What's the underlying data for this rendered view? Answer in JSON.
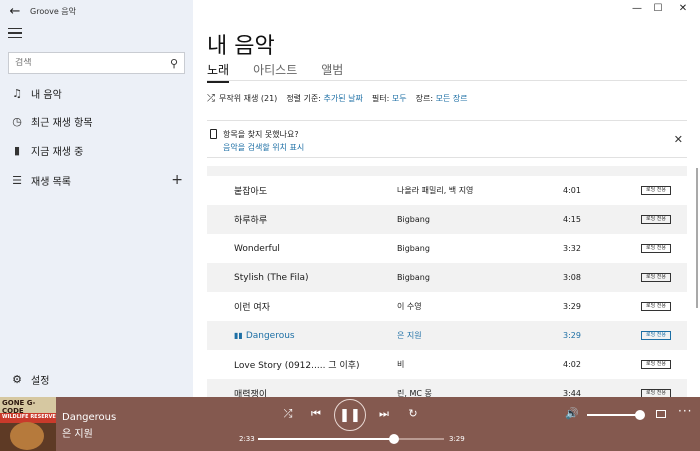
{
  "app": {
    "title": "Groove 음악"
  },
  "search": {
    "placeholder": "검색"
  },
  "sidebar": {
    "items": [
      {
        "label": "내 음악",
        "icon": "music-note-icon"
      },
      {
        "label": "최근 재생 항목",
        "icon": "clock-icon"
      },
      {
        "label": "지금 재생 중",
        "icon": "bars-icon"
      },
      {
        "label": "재생 목록",
        "icon": "list-icon"
      }
    ],
    "add_symbol": "+",
    "settings_label": "설정"
  },
  "main": {
    "title": "내 음악",
    "tabs": [
      {
        "label": "노래",
        "active": true
      },
      {
        "label": "아티스트",
        "active": false
      },
      {
        "label": "앨범",
        "active": false
      }
    ],
    "filters": {
      "shuffle_label": "무작위 재생 (21)",
      "sort_label": "정렬 기준:",
      "sort_value": "추가된 날짜",
      "filter_label": "필터:",
      "filter_value": "모두",
      "genre_label": "장르:",
      "genre_value": "모든 장르"
    },
    "notice": {
      "line1": "항목을 찾지 못했나요?",
      "line2": "음악을 검색할 위치 표시"
    }
  },
  "songs": [
    {
      "title": "붙잡아도",
      "artist": "나올라 패밀리, 백 지영",
      "duration": "4:01",
      "badge": "로딩 전용",
      "playing": false
    },
    {
      "title": "하루하루",
      "artist": "Bigbang",
      "duration": "4:15",
      "badge": "로딩 전용",
      "playing": false
    },
    {
      "title": "Wonderful",
      "artist": "Bigbang",
      "duration": "3:32",
      "badge": "로딩 전용",
      "playing": false
    },
    {
      "title": "Stylish (The Fila)",
      "artist": "Bigbang",
      "duration": "3:08",
      "badge": "로딩 전용",
      "playing": false
    },
    {
      "title": "이런 여자",
      "artist": "이 수영",
      "duration": "3:29",
      "badge": "로딩 전용",
      "playing": false
    },
    {
      "title": "Dangerous",
      "artist": "은 지원",
      "duration": "3:29",
      "badge": "로딩 전용",
      "playing": true
    },
    {
      "title": "Love Story (0912..... 그 이후)",
      "artist": "비",
      "duration": "4:02",
      "badge": "로딩 전용",
      "playing": false
    },
    {
      "title": "매력쟁이",
      "artist": "린, MC 몽",
      "duration": "3:44",
      "badge": "로딩 전용",
      "playing": false
    }
  ],
  "player": {
    "track_title": "Dangerous",
    "track_artist": "은 지원",
    "album_art_text": "GONE G-CODE",
    "album_art_subtext": "WILDLIFE RESERVE",
    "time_elapsed": "2:33",
    "time_total": "3:29",
    "progress": 0.73,
    "volume": 1.0
  },
  "colors": {
    "accent": "#1d6fa5",
    "sidebar_bg": "#ecf0f7",
    "player_bg": "#84594f"
  }
}
